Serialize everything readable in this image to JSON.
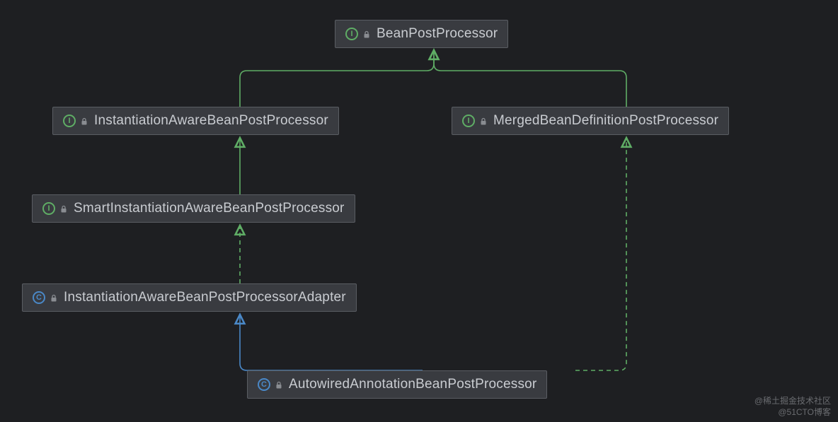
{
  "nodes": {
    "bpp": {
      "label": "BeanPostProcessor",
      "kind": "interface"
    },
    "iabpp": {
      "label": "InstantiationAwareBeanPostProcessor",
      "kind": "interface"
    },
    "mbdpp": {
      "label": "MergedBeanDefinitionPostProcessor",
      "kind": "interface"
    },
    "siabpp": {
      "label": "SmartInstantiationAwareBeanPostProcessor",
      "kind": "interface"
    },
    "iabppa": {
      "label": "InstantiationAwareBeanPostProcessorAdapter",
      "kind": "class"
    },
    "aabpp": {
      "label": "AutowiredAnnotationBeanPostProcessor",
      "kind": "class"
    }
  },
  "edges": [
    {
      "from": "iabpp",
      "to": "bpp",
      "style": "solid",
      "color": "#5fad65"
    },
    {
      "from": "mbdpp",
      "to": "bpp",
      "style": "solid",
      "color": "#5fad65"
    },
    {
      "from": "siabpp",
      "to": "iabpp",
      "style": "solid",
      "color": "#5fad65"
    },
    {
      "from": "iabppa",
      "to": "siabpp",
      "style": "dashed",
      "color": "#5fad65"
    },
    {
      "from": "aabpp",
      "to": "iabppa",
      "style": "solid",
      "color": "#4a88c7"
    },
    {
      "from": "aabpp",
      "to": "mbdpp",
      "style": "dashed",
      "color": "#5fad65"
    }
  ],
  "watermarks": {
    "w1": "@稀土掘金技术社区",
    "w2": "@51CTO博客"
  },
  "icon_letters": {
    "interface": "I",
    "class": "C"
  }
}
